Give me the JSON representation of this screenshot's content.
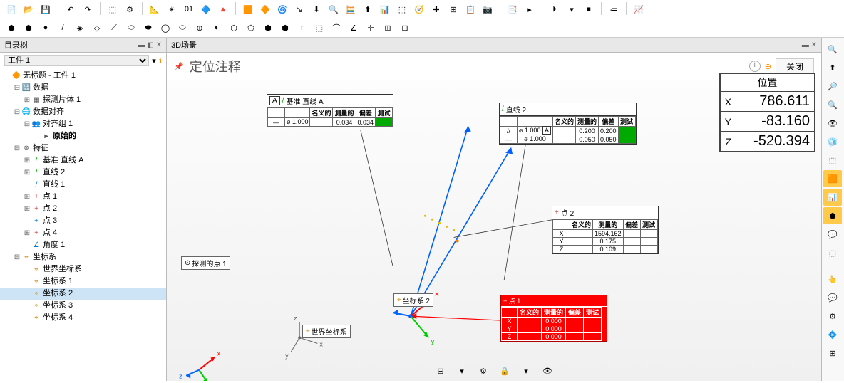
{
  "toolbar_icons_row1": [
    "📄",
    "📂",
    "💾",
    "|",
    "↶",
    "↷",
    "|",
    "⬚",
    "⚙",
    "|",
    "📐",
    "✴",
    "01",
    "🔷",
    "🔺",
    "|",
    "🟧",
    "🔶",
    "🌀",
    "↘",
    "⬇",
    "🔍",
    "🧮",
    "⬆",
    "📊",
    "⬚",
    "🧭",
    "✚",
    "⊞",
    "📋",
    "📷",
    "|",
    "📑",
    "▸",
    "|",
    "⏵",
    "▾",
    "⏹",
    "|",
    "≔",
    "|",
    "📈"
  ],
  "toolbar_icons_row2": [
    "⬢",
    "⬢",
    "●",
    "/",
    "◈",
    "◇",
    "⟋",
    "⬭",
    "⬬",
    "◯",
    "⬭",
    "⊕",
    "◐",
    "⬡",
    "⬠",
    "⬢",
    "⬢",
    "r",
    "⬚",
    "⌒",
    "∠",
    "✛",
    "⊞",
    "⊟"
  ],
  "tree_panel": {
    "title": "目录树",
    "workpiece_label": "工件 1"
  },
  "tree": [
    {
      "indent": 0,
      "exp": "",
      "icon": "🔶",
      "label": "无标题 - 工件 1",
      "color": "#c80"
    },
    {
      "indent": 1,
      "exp": "⊟",
      "icon": "🔢",
      "label": "数据"
    },
    {
      "indent": 2,
      "exp": "⊞",
      "icon": "▦",
      "label": "探测片体 1"
    },
    {
      "indent": 1,
      "exp": "⊟",
      "icon": "🌐",
      "label": "数据对齐"
    },
    {
      "indent": 2,
      "exp": "⊟",
      "icon": "👥",
      "label": "对齐组 1",
      "color": "#c44"
    },
    {
      "indent": 3,
      "exp": " ",
      "icon": "▸",
      "label": "原始的",
      "bold": true
    },
    {
      "indent": 1,
      "exp": "⊟",
      "icon": "⊛",
      "label": "特征"
    },
    {
      "indent": 2,
      "exp": "⊞",
      "icon": "/",
      "label": "基准 直线 A",
      "color": "#0a0"
    },
    {
      "indent": 2,
      "exp": "⊞",
      "icon": "/",
      "label": "直线 2",
      "color": "#0a0"
    },
    {
      "indent": 2,
      "exp": " ",
      "icon": "/",
      "label": "直线 1",
      "color": "#07c"
    },
    {
      "indent": 2,
      "exp": "⊞",
      "icon": "+",
      "label": "点 1",
      "color": "#c44"
    },
    {
      "indent": 2,
      "exp": "⊞",
      "icon": "+",
      "label": "点 2",
      "color": "#c44"
    },
    {
      "indent": 2,
      "exp": " ",
      "icon": "+",
      "label": "点 3",
      "color": "#07c"
    },
    {
      "indent": 2,
      "exp": "⊞",
      "icon": "+",
      "label": "点 4",
      "color": "#c44"
    },
    {
      "indent": 2,
      "exp": " ",
      "icon": "∠",
      "label": "角度 1",
      "color": "#07c"
    },
    {
      "indent": 1,
      "exp": "⊟",
      "icon": "⌖",
      "label": "坐标系",
      "color": "#c80"
    },
    {
      "indent": 2,
      "exp": " ",
      "icon": "⌖",
      "label": "世界坐标系",
      "color": "#c80"
    },
    {
      "indent": 2,
      "exp": " ",
      "icon": "⌖",
      "label": "坐标系 1",
      "color": "#c80"
    },
    {
      "indent": 2,
      "exp": " ",
      "icon": "⌖",
      "label": "坐标系 2",
      "color": "#c80",
      "selected": true
    },
    {
      "indent": 2,
      "exp": " ",
      "icon": "⌖",
      "label": "坐标系 3",
      "color": "#c80"
    },
    {
      "indent": 2,
      "exp": " ",
      "icon": "⌖",
      "label": "坐标系 4",
      "color": "#c80"
    }
  ],
  "scene": {
    "panel_title": "3D场景",
    "title": "定位注释",
    "close": "关闭",
    "probe_point_label": "探测的点 1",
    "world_cs_label": "世界坐标系",
    "cs2_label": "坐标系 2"
  },
  "callouts": {
    "lineA": {
      "tag": "A",
      "title": "基准 直线 A",
      "headers": [
        "名义的",
        "测量的",
        "偏差",
        "测试"
      ],
      "row_sym": "⌀",
      "tol": "1.000",
      "meas1": "0.034",
      "meas2": "0.034"
    },
    "line2": {
      "title": "直线 2",
      "headers": [
        "名义的",
        "测量的",
        "偏差",
        "测试"
      ],
      "r1": {
        "sym": "//",
        "tol": "1.000",
        "ref": "A",
        "v1": "0.200",
        "v2": "0.200"
      },
      "r2": {
        "sym": "⌀",
        "tol": "1.000",
        "v1": "0.050",
        "v2": "0.050"
      }
    },
    "point2": {
      "title": "点 2",
      "headers": [
        "名义的",
        "测量的",
        "偏差",
        "测试"
      ],
      "rows": [
        {
          "axis": "X",
          "val": "1594.162"
        },
        {
          "axis": "Y",
          "val": "0.175"
        },
        {
          "axis": "Z",
          "val": "0.109"
        }
      ]
    },
    "point1_red": {
      "title": "点 1",
      "headers": [
        "名义的",
        "测量的",
        "偏差",
        "测试"
      ],
      "rows": [
        {
          "axis": "X",
          "val": "0.000"
        },
        {
          "axis": "Y",
          "val": "0.000"
        },
        {
          "axis": "Z",
          "val": "0.000"
        }
      ]
    }
  },
  "position": {
    "header": "位置",
    "x_label": "X",
    "x": "786.611",
    "y_label": "Y",
    "y": "-83.160",
    "z_label": "Z",
    "z": "-520.394"
  },
  "right_tools": [
    "🔍",
    "⬆",
    "🔎",
    "🔍",
    "👁",
    "🧊",
    "⬚",
    "🟧",
    "📊",
    "⬢",
    "💬",
    "⬚",
    "|",
    "👆",
    "💬",
    "⚙",
    "💠",
    "⊞"
  ],
  "bottom_icons": [
    "⊟",
    "▾",
    "⚙",
    "🔒",
    "▾",
    "👁"
  ],
  "chart_data": null
}
